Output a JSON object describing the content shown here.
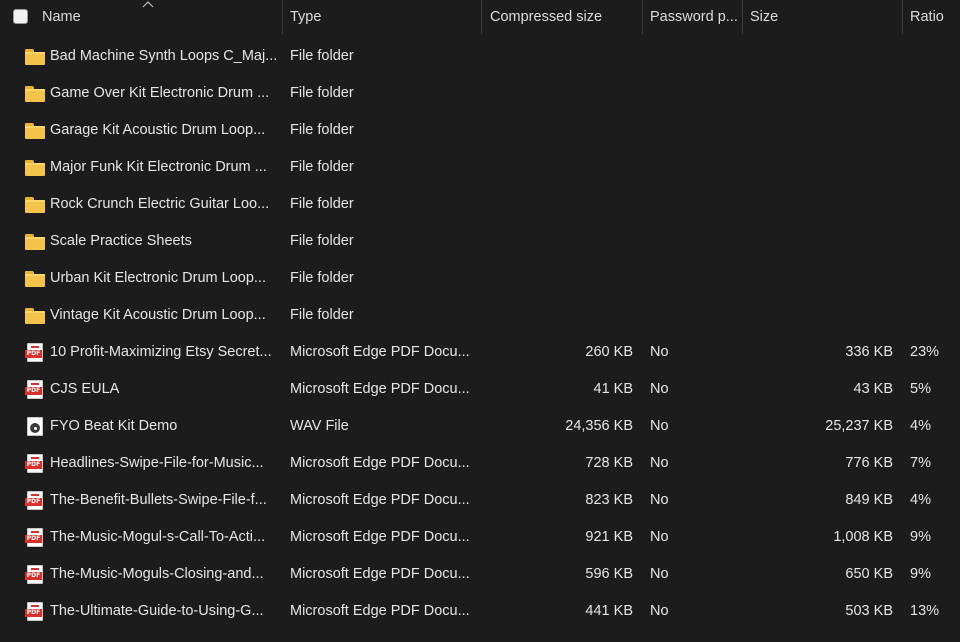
{
  "columns": {
    "name": "Name",
    "type": "Type",
    "compressed_size": "Compressed size",
    "password": "Password p...",
    "size": "Size",
    "ratio": "Ratio"
  },
  "sort": {
    "column": "name",
    "direction": "ascending"
  },
  "colors": {
    "folder": "#f4c34a",
    "pdf": "#d9302b",
    "background": "#1c1c1c"
  },
  "rows": [
    {
      "icon": "folder-icon",
      "name": "Bad Machine Synth Loops C_Maj...",
      "type": "File folder",
      "compressed": "",
      "password": "",
      "size": "",
      "ratio": ""
    },
    {
      "icon": "folder-icon",
      "name": "Game Over Kit Electronic Drum ...",
      "type": "File folder",
      "compressed": "",
      "password": "",
      "size": "",
      "ratio": ""
    },
    {
      "icon": "folder-icon",
      "name": "Garage Kit Acoustic Drum Loop...",
      "type": "File folder",
      "compressed": "",
      "password": "",
      "size": "",
      "ratio": ""
    },
    {
      "icon": "folder-icon",
      "name": "Major Funk Kit Electronic Drum ...",
      "type": "File folder",
      "compressed": "",
      "password": "",
      "size": "",
      "ratio": ""
    },
    {
      "icon": "folder-icon",
      "name": "Rock Crunch Electric Guitar Loo...",
      "type": "File folder",
      "compressed": "",
      "password": "",
      "size": "",
      "ratio": ""
    },
    {
      "icon": "folder-icon",
      "name": "Scale Practice Sheets",
      "type": "File folder",
      "compressed": "",
      "password": "",
      "size": "",
      "ratio": ""
    },
    {
      "icon": "folder-icon",
      "name": "Urban Kit Electronic Drum Loop...",
      "type": "File folder",
      "compressed": "",
      "password": "",
      "size": "",
      "ratio": ""
    },
    {
      "icon": "folder-icon",
      "name": "Vintage Kit Acoustic Drum Loop...",
      "type": "File folder",
      "compressed": "",
      "password": "",
      "size": "",
      "ratio": ""
    },
    {
      "icon": "pdf-icon",
      "name": "10 Profit-Maximizing Etsy Secret...",
      "type": "Microsoft Edge PDF Docu...",
      "compressed": "260 KB",
      "password": "No",
      "size": "336 KB",
      "ratio": "23%"
    },
    {
      "icon": "pdf-icon",
      "name": "CJS EULA",
      "type": "Microsoft Edge PDF Docu...",
      "compressed": "41 KB",
      "password": "No",
      "size": "43 KB",
      "ratio": "5%"
    },
    {
      "icon": "wav-icon",
      "name": "FYO Beat Kit Demo",
      "type": "WAV File",
      "compressed": "24,356 KB",
      "password": "No",
      "size": "25,237 KB",
      "ratio": "4%"
    },
    {
      "icon": "pdf-icon",
      "name": "Headlines-Swipe-File-for-Music...",
      "type": "Microsoft Edge PDF Docu...",
      "compressed": "728 KB",
      "password": "No",
      "size": "776 KB",
      "ratio": "7%"
    },
    {
      "icon": "pdf-icon",
      "name": "The-Benefit-Bullets-Swipe-File-f...",
      "type": "Microsoft Edge PDF Docu...",
      "compressed": "823 KB",
      "password": "No",
      "size": "849 KB",
      "ratio": "4%"
    },
    {
      "icon": "pdf-icon",
      "name": "The-Music-Mogul-s-Call-To-Acti...",
      "type": "Microsoft Edge PDF Docu...",
      "compressed": "921 KB",
      "password": "No",
      "size": "1,008 KB",
      "ratio": "9%"
    },
    {
      "icon": "pdf-icon",
      "name": "The-Music-Moguls-Closing-and...",
      "type": "Microsoft Edge PDF Docu...",
      "compressed": "596 KB",
      "password": "No",
      "size": "650 KB",
      "ratio": "9%"
    },
    {
      "icon": "pdf-icon",
      "name": "The-Ultimate-Guide-to-Using-G...",
      "type": "Microsoft Edge PDF Docu...",
      "compressed": "441 KB",
      "password": "No",
      "size": "503 KB",
      "ratio": "13%"
    }
  ]
}
